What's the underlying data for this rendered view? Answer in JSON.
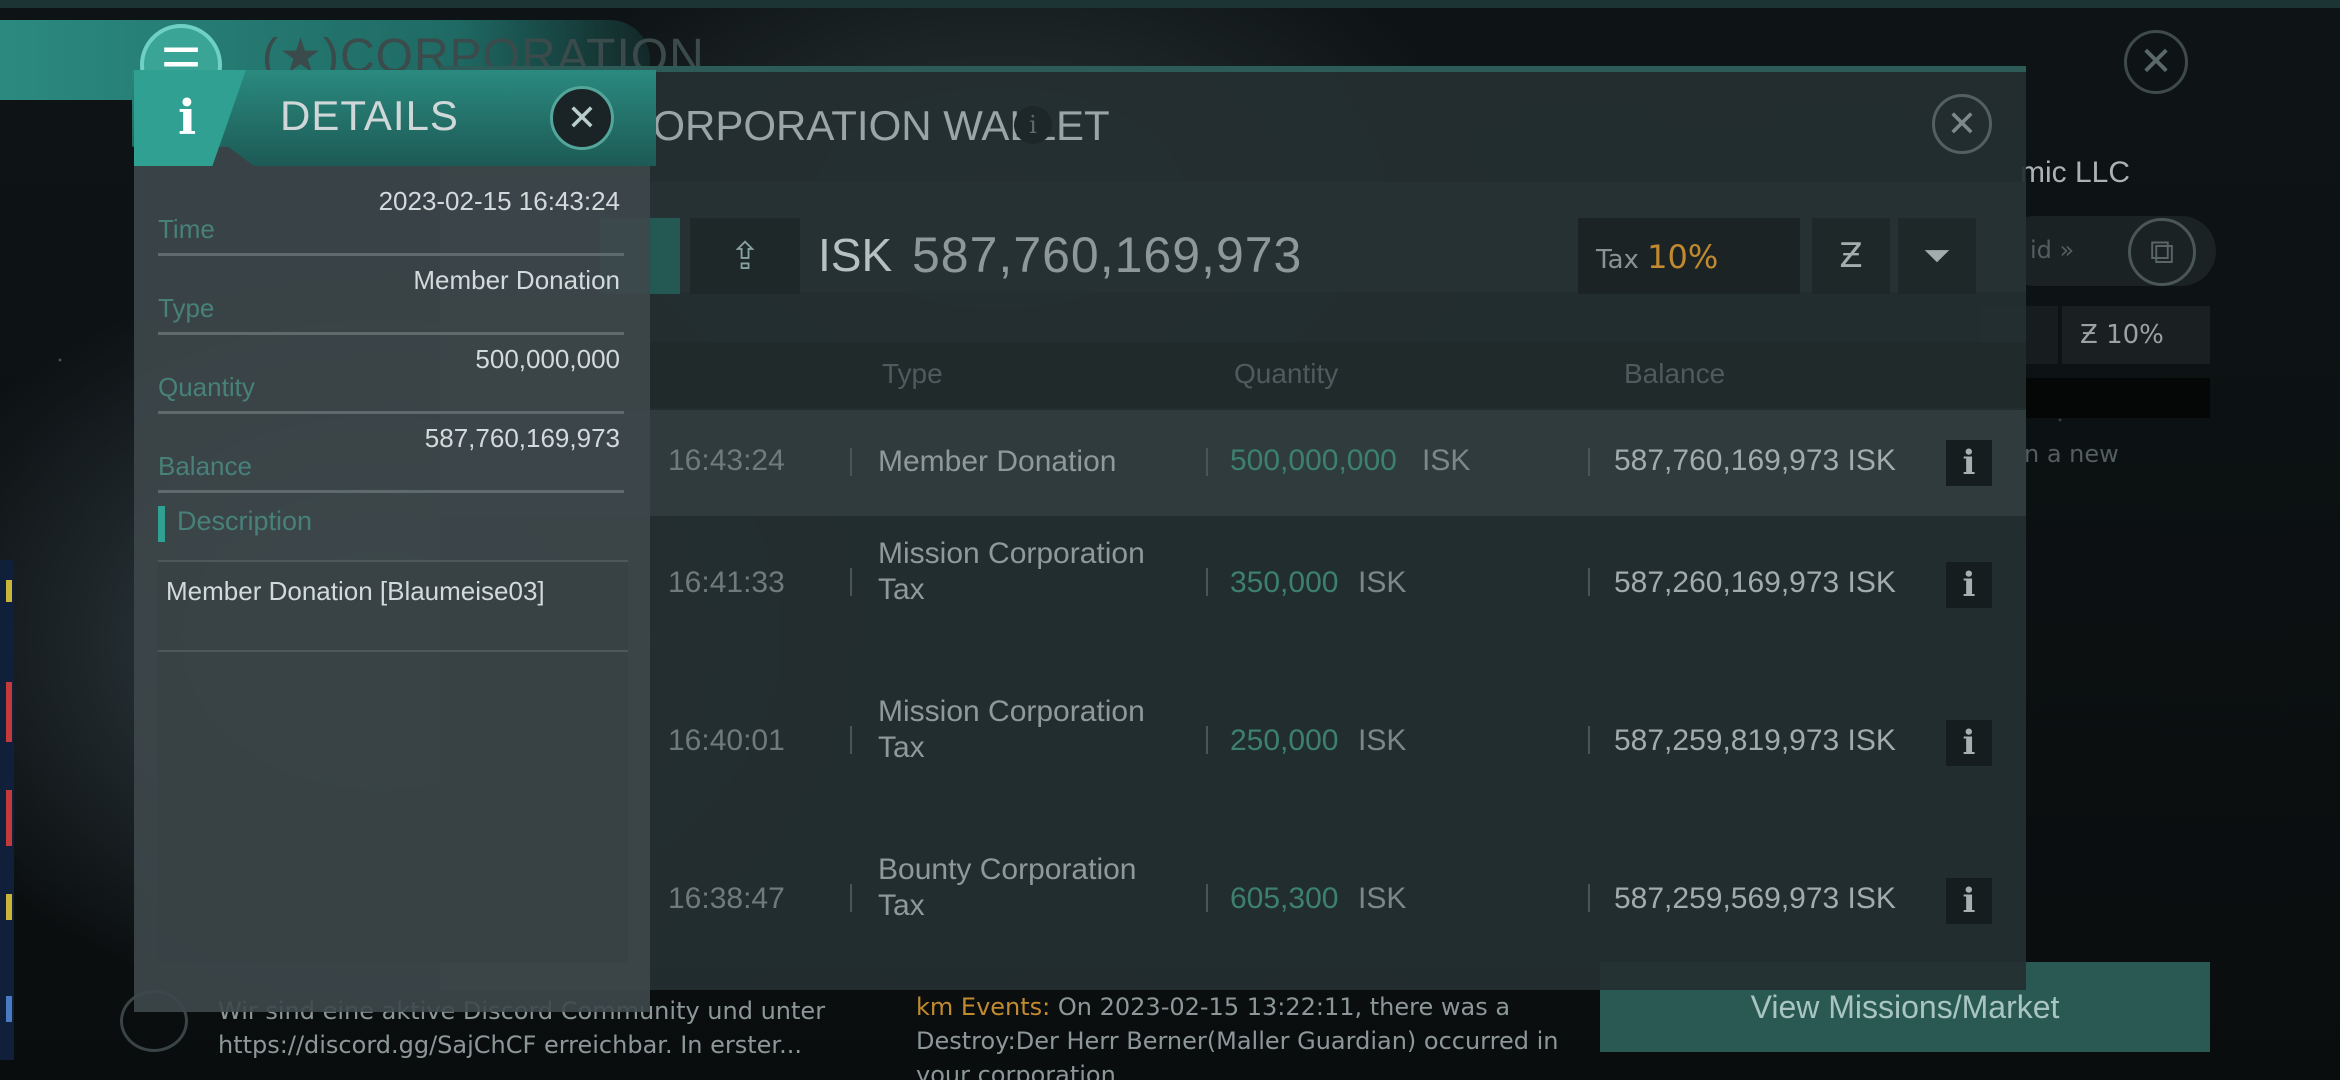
{
  "background": {
    "corp_title": "(★)CORPORATION",
    "company_name": "mic LLC",
    "paid_label": "id",
    "tax_value": "10%",
    "hint_text": "n a new",
    "view_button": "View Missions/Market",
    "feed_left": "Wir sind eine aktive Discord Community und unter https://discord.gg/SajChCF erreichbar. In erster...",
    "feed_right_highlight": "km Events:",
    "feed_right_text": " On 2023-02-15 13:22:11, there was a Destroy:Der Herr Berner(Maller Guardian) occurred in your corporation."
  },
  "wallet": {
    "title": "CORPORATION WALLET",
    "currency": "ISK",
    "balance": "587,760,169,973",
    "tax_label": "Tax",
    "tax_value": "10%",
    "columns": {
      "type": "Type",
      "quantity": "Quantity",
      "balance": "Balance"
    },
    "rows": [
      {
        "time": "16:43:24",
        "type": "Member Donation",
        "quantity": "500,000,000",
        "unit": "ISK",
        "balance": "587,760,169,973 ISK"
      },
      {
        "time": "16:41:33",
        "type": "Mission Corporation Tax",
        "quantity": "350,000",
        "unit": "ISK",
        "balance": "587,260,169,973 ISK"
      },
      {
        "time": "16:40:01",
        "type": "Mission Corporation Tax",
        "quantity": "250,000",
        "unit": "ISK",
        "balance": "587,259,819,973 ISK"
      },
      {
        "time": "16:38:47",
        "type": "Bounty Corporation Tax",
        "quantity": "605,300",
        "unit": "ISK",
        "balance": "587,259,569,973 ISK"
      }
    ]
  },
  "details": {
    "title": "DETAILS",
    "time_label": "Time",
    "time_value": "2023-02-15 16:43:24",
    "type_label": "Type",
    "type_value": "Member Donation",
    "quantity_label": "Quantity",
    "quantity_value": "500,000,000",
    "balance_label": "Balance",
    "balance_value": "587,760,169,973",
    "description_label": "Description",
    "description_text": "Member Donation [Blaumeise03]"
  },
  "icons": {
    "menu": "menu-icon",
    "close": "close-icon",
    "info": "info-icon",
    "export": "export-icon",
    "tax_settings": "tax-settings-icon",
    "filter": "filter-icon"
  },
  "colors": {
    "accent": "#2fa092",
    "tax_highlight": "#c28a2f",
    "quantity_green": "#3d8070"
  }
}
